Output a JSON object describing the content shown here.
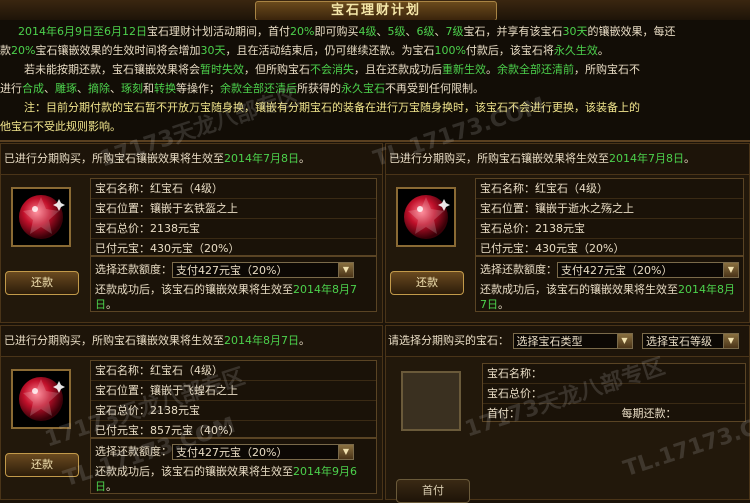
{
  "title": "宝石理财计划",
  "notice": [
    [
      {
        "t": "2014年6月9日至6月12日",
        "c": "g"
      },
      {
        "t": "宝石理财计划活动期间，首付",
        "c": "w"
      },
      {
        "t": "20%",
        "c": "g"
      },
      {
        "t": "即可购买",
        "c": "w"
      },
      {
        "t": "4级",
        "c": "g"
      },
      {
        "t": "、",
        "c": "w"
      },
      {
        "t": "5级",
        "c": "g"
      },
      {
        "t": "、",
        "c": "w"
      },
      {
        "t": "6级",
        "c": "g"
      },
      {
        "t": "、",
        "c": "w"
      },
      {
        "t": "7级",
        "c": "g"
      },
      {
        "t": "宝石，并享有该宝石",
        "c": "w"
      },
      {
        "t": "30天",
        "c": "g"
      },
      {
        "t": "的镶嵌效果，每还",
        "c": "w"
      }
    ],
    [
      {
        "t": "款",
        "c": "w"
      },
      {
        "t": "20%",
        "c": "g"
      },
      {
        "t": "宝石镶嵌效果的生效时间将会增加",
        "c": "w"
      },
      {
        "t": "30天",
        "c": "g"
      },
      {
        "t": "，且在活动结束后，仍可继续还款。为宝石",
        "c": "w"
      },
      {
        "t": "100%",
        "c": "g"
      },
      {
        "t": "付款后，该宝石将",
        "c": "w"
      },
      {
        "t": "永久生效",
        "c": "g"
      },
      {
        "t": "。",
        "c": "w"
      }
    ],
    [
      {
        "t": "若未能按期还款，宝石镶嵌效果将会",
        "c": "w"
      },
      {
        "t": "暂时失效",
        "c": "g"
      },
      {
        "t": "，但所购宝石",
        "c": "w"
      },
      {
        "t": "不会消失",
        "c": "g"
      },
      {
        "t": "，且在还款成功后",
        "c": "w"
      },
      {
        "t": "重新生效",
        "c": "g"
      },
      {
        "t": "。",
        "c": "w"
      },
      {
        "t": "余款全部还清前",
        "c": "g"
      },
      {
        "t": "，所购宝石不",
        "c": "w"
      }
    ],
    [
      {
        "t": "进行",
        "c": "w"
      },
      {
        "t": "合成",
        "c": "g"
      },
      {
        "t": "、",
        "c": "w"
      },
      {
        "t": "雕琢",
        "c": "g"
      },
      {
        "t": "、",
        "c": "w"
      },
      {
        "t": "摘除",
        "c": "g"
      },
      {
        "t": "、",
        "c": "w"
      },
      {
        "t": "琢刻",
        "c": "g"
      },
      {
        "t": "和",
        "c": "w"
      },
      {
        "t": "转换",
        "c": "g"
      },
      {
        "t": "等操作；",
        "c": "w"
      },
      {
        "t": "余款全部还清后",
        "c": "g"
      },
      {
        "t": "所获得的",
        "c": "w"
      },
      {
        "t": "永久宝石",
        "c": "g"
      },
      {
        "t": "不再受到任何限制。",
        "c": "w"
      }
    ],
    [
      {
        "t": "注：目前分期付款的宝石暂不开放万宝随身换，镶嵌有分期宝石的装备在进行万宝随身换时，该宝石不会进行更换，该装备上的",
        "c": "y"
      }
    ],
    [
      {
        "t": "他宝石不受此规则影响。",
        "c": "y"
      }
    ]
  ],
  "panels": [
    {
      "header_prefix": "已进行分期购买，所购宝石镶嵌效果将生效至",
      "header_date": "2014年7月8日",
      "header_suffix": "。",
      "rows": [
        "宝石名称：红宝石（4级）",
        "宝石位置：镶嵌于玄铁盔之上",
        "宝石总价：2138元宝",
        "已付元宝：430元宝（20%）"
      ],
      "select_label": "选择还款额度：",
      "select_value": "支付427元宝（20%）",
      "result_prefix": "还款成功后，该宝石的镶嵌效果将生效至",
      "result_date": "2014年8月7日",
      "result_suffix": "。",
      "button": "还款"
    },
    {
      "header_prefix": "已进行分期购买，所购宝石镶嵌效果将生效至",
      "header_date": "2014年7月8日",
      "header_suffix": "。",
      "rows": [
        "宝石名称：红宝石（4级）",
        "宝石位置：镶嵌于逝水之殇之上",
        "宝石总价：2138元宝",
        "已付元宝：430元宝（20%）"
      ],
      "select_label": "选择还款额度：",
      "select_value": "支付427元宝（20%）",
      "result_prefix": "还款成功后，该宝石的镶嵌效果将生效至",
      "result_date": "2014年8月7日",
      "result_suffix": "。",
      "button": "还款"
    },
    {
      "header_prefix": "已进行分期购买，所购宝石镶嵌效果将生效至",
      "header_date": "2014年8月7日",
      "header_suffix": "。",
      "rows": [
        "宝石名称：红宝石（4级）",
        "宝石位置：镶嵌于飞蝗石之上",
        "宝石总价：2138元宝",
        "已付元宝：857元宝（40%）"
      ],
      "select_label": "选择还款额度：",
      "select_value": "支付427元宝（20%）",
      "result_prefix": "还款成功后，该宝石的镶嵌效果将生效至",
      "result_date": "2014年9月6日",
      "result_suffix": "。",
      "button": "还款"
    }
  ],
  "purchase": {
    "label": "请选择分期购买的宝石：",
    "type_select": "选择宝石类型",
    "level_select": "选择宝石等级",
    "row_name": "宝石名称：",
    "row_total": "宝石总价：",
    "row_down": "首付：",
    "row_each": "每期还款：",
    "button": "首付"
  },
  "watermarks": [
    "17173天龙八部专区",
    "TL.17173.COM"
  ],
  "colors": {
    "highlight_green": "#4cd14c",
    "note_yellow": "#f0e48c",
    "gem_red": "#c0102a",
    "gold_border": "#c29a4a"
  }
}
